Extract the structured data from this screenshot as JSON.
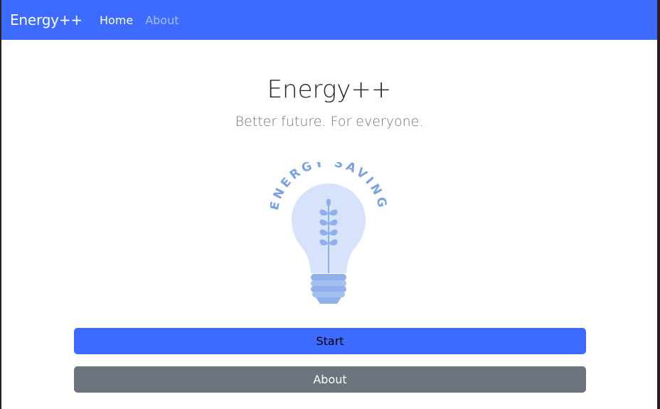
{
  "navbar": {
    "brand": "Energy++",
    "links": [
      "Home",
      "About"
    ]
  },
  "hero": {
    "title": "Energy++",
    "subtitle": "Better future. For everyone."
  },
  "illustration": {
    "arc_text": "ENERGY SAVING",
    "icon": "lightbulb-with-plant"
  },
  "buttons": {
    "start": "Start",
    "about": "About"
  },
  "colors": {
    "primary": "#3d6bff",
    "secondary": "#6c757d",
    "bulb_fill": "#d6e3fb",
    "bulb_accent": "#7aa1e6"
  }
}
